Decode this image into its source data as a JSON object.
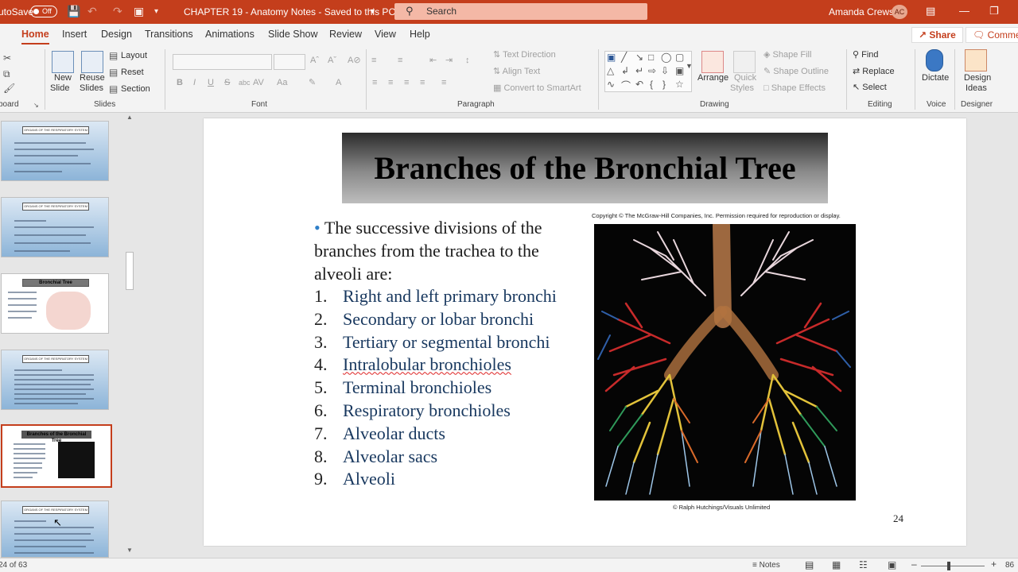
{
  "titlebar": {
    "autosave_label": "utoSave",
    "autosave_state": "Off",
    "doc_title": "CHAPTER 19 - Anatomy Notes  -  Saved to this PC",
    "search_placeholder": "Search",
    "user_name": "Amanda Crews",
    "user_initials": "AC"
  },
  "tabs": [
    "Home",
    "Insert",
    "Design",
    "Transitions",
    "Animations",
    "Slide Show",
    "Review",
    "View",
    "Help"
  ],
  "share_label": "Share",
  "comments_label": "Commen",
  "ribbon": {
    "clipboard": {
      "group": "board"
    },
    "slides": {
      "new_slide": "New",
      "new_slide2": "Slide",
      "reuse": "Reuse",
      "reuse2": "Slides",
      "layout": "Layout",
      "reset": "Reset",
      "section": "Section",
      "group": "Slides"
    },
    "font": {
      "bold": "B",
      "italic": "I",
      "underline": "U",
      "strike": "S",
      "spacing": "AV",
      "group": "Font"
    },
    "paragraph": {
      "text_direction": "Text Direction",
      "align_text": "Align Text",
      "convert_smartart": "Convert to SmartArt",
      "group": "Paragraph"
    },
    "drawing": {
      "arrange": "Arrange",
      "quick": "Quick",
      "styles": "Styles",
      "shape_fill": "Shape Fill",
      "shape_outline": "Shape Outline",
      "shape_effects": "Shape Effects",
      "group": "Drawing"
    },
    "editing": {
      "find": "Find",
      "replace": "Replace",
      "select": "Select",
      "group": "Editing"
    },
    "voice": {
      "dictate": "Dictate",
      "group": "Voice"
    },
    "designer": {
      "design": "Design",
      "ideas": "Ideas",
      "group": "Designer"
    }
  },
  "thumbnails": {
    "header_text": "ORGANS OF THE RESPIRATORY SYSTEM",
    "bronchial_tree": "Bronchial Tree",
    "branches": "Branches of the Bronchial Tree"
  },
  "slide": {
    "title": "Branches of the Bronchial Tree",
    "intro": "The successive divisions of the branches from the trachea to the alveoli are:",
    "bullet": "•",
    "items": [
      {
        "n": "1.",
        "text": "Right and left primary bronchi"
      },
      {
        "n": "2.",
        "text": "Secondary or lobar bronchi"
      },
      {
        "n": "3.",
        "text": "Tertiary or segmental bronchi"
      },
      {
        "n": "4.",
        "text": "Intralobular bronchioles"
      },
      {
        "n": "5.",
        "text": "Terminal bronchioles"
      },
      {
        "n": "6.",
        "text": "Respiratory bronchioles"
      },
      {
        "n": "7.",
        "text": "Alveolar ducts"
      },
      {
        "n": "8.",
        "text": "Alveolar sacs"
      },
      {
        "n": "9.",
        "text": "Alveoli"
      }
    ],
    "copyright": "Copyright © The McGraw-Hill Companies, Inc. Permission required for reproduction or display.",
    "credit": "© Ralph Hutchings/Visuals Unlimited",
    "page_number": "24"
  },
  "status": {
    "slide_count": "24 of 63",
    "notes": "Notes",
    "zoom": "86"
  },
  "colors": {
    "accent": "#c43e1c",
    "list_text": "#17375e",
    "bullet": "#2f7fc8"
  }
}
